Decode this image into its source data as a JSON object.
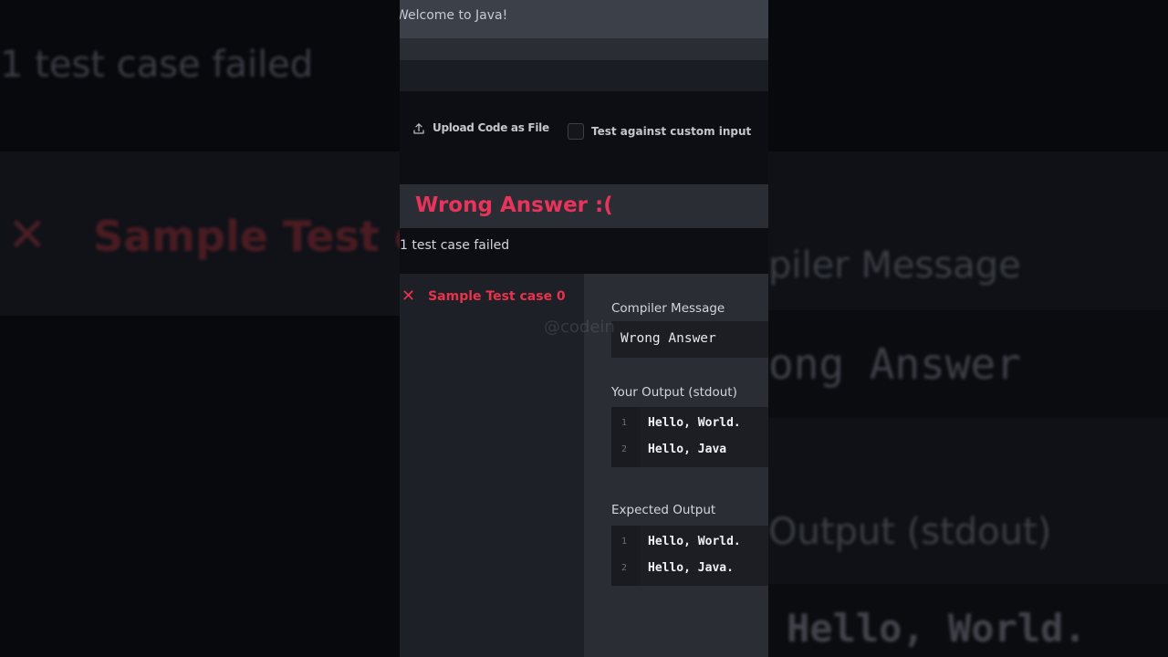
{
  "background": {
    "test_case_summary": "1 test case failed",
    "test_case_label": "Sample Test c",
    "compiler_message_heading": "piler Message",
    "compiler_message_value": "ong Answer",
    "output_heading": "Output (stdout)",
    "output_line": "Hello, World."
  },
  "editor": {
    "title": "Welcome to Java!"
  },
  "actions": {
    "upload_label": "Upload Code as File",
    "custom_input_label": "Test against custom input",
    "custom_input_checked": false
  },
  "result": {
    "title": "Wrong Answer :(",
    "summary": "1 test case failed",
    "status_color": "#e8335a"
  },
  "test_cases": [
    {
      "label": "Sample Test case 0",
      "status": "failed"
    }
  ],
  "details": {
    "compiler_message_label": "Compiler Message",
    "compiler_message": "Wrong Answer",
    "your_output_label": "Your Output (stdout)",
    "your_output": [
      {
        "line": "1",
        "text": "Hello, World."
      },
      {
        "line": "2",
        "text": "Hello, Java"
      }
    ],
    "expected_output_label": "Expected Output",
    "expected_output": [
      {
        "line": "1",
        "text": "Hello, World."
      },
      {
        "line": "2",
        "text": "Hello, Java."
      }
    ]
  },
  "watermark": "@codein",
  "icons": {
    "upload": "upload-icon",
    "failed": "close-icon"
  }
}
